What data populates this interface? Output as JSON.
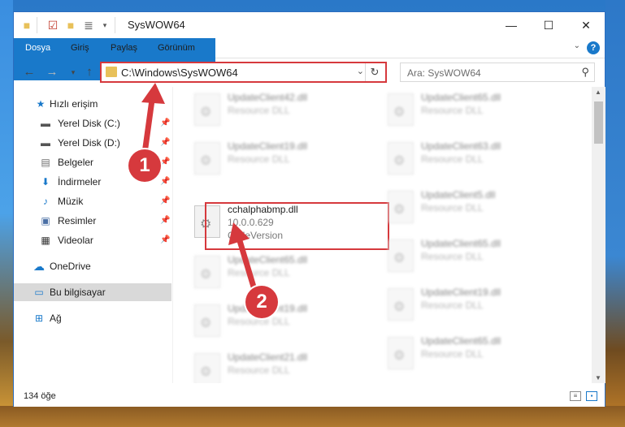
{
  "window": {
    "title": "SysWOW64",
    "buttons": {
      "minimize": "—",
      "maximize": "☐",
      "close": "✕"
    }
  },
  "ribbon": {
    "tabs": [
      "Dosya",
      "Giriş",
      "Paylaş",
      "Görünüm"
    ],
    "help": "?"
  },
  "address": {
    "path": "C:\\Windows\\SysWOW64",
    "search_placeholder": "Ara: SysWOW64"
  },
  "sidebar": {
    "quick_access": "Hızlı erişim",
    "items": [
      {
        "label": "Yerel Disk (C:)",
        "icon": "drive-icon"
      },
      {
        "label": "Yerel Disk (D:)",
        "icon": "drive-icon"
      },
      {
        "label": "Belgeler",
        "icon": "documents-icon"
      },
      {
        "label": "İndirmeler",
        "icon": "download-icon"
      },
      {
        "label": "Müzik",
        "icon": "music-icon"
      },
      {
        "label": "Resimler",
        "icon": "pictures-icon"
      },
      {
        "label": "Videolar",
        "icon": "videos-icon"
      }
    ],
    "onedrive": "OneDrive",
    "this_pc": "Bu bilgisayar",
    "network": "Ağ"
  },
  "files": {
    "col1": [
      {
        "name": "UpdateClient42.dll",
        "desc": "Resource DLL"
      },
      {
        "name": "UpdateClient19.dll",
        "desc": "Resource DLL"
      },
      {
        "name": "cchalphabmp.dll",
        "desc": "10.0.0.629",
        "desc2": "CFileVersion"
      },
      {
        "name": "UpdateClient65.dll",
        "desc": "Resource DLL"
      },
      {
        "name": "UpdateClient19.dll",
        "desc": "Resource DLL"
      },
      {
        "name": "UpdateClient21.dll",
        "desc": "Resource DLL"
      }
    ],
    "col2": [
      {
        "name": "UpdateClient65.dll",
        "desc": "Resource DLL"
      },
      {
        "name": "UpdateClient63.dll",
        "desc": "Resource DLL"
      },
      {
        "name": "UpdateClient5.dll",
        "desc": "Resource DLL"
      },
      {
        "name": "UpdateClient65.dll",
        "desc": "Resource DLL"
      },
      {
        "name": "UpdateClient19.dll",
        "desc": "Resource DLL"
      },
      {
        "name": "UpdateClient65.dll",
        "desc": "Resource DLL"
      }
    ]
  },
  "status": {
    "count": "134 öğe"
  },
  "annotations": {
    "badge1": "1",
    "badge2": "2",
    "color": "#d6393d"
  }
}
